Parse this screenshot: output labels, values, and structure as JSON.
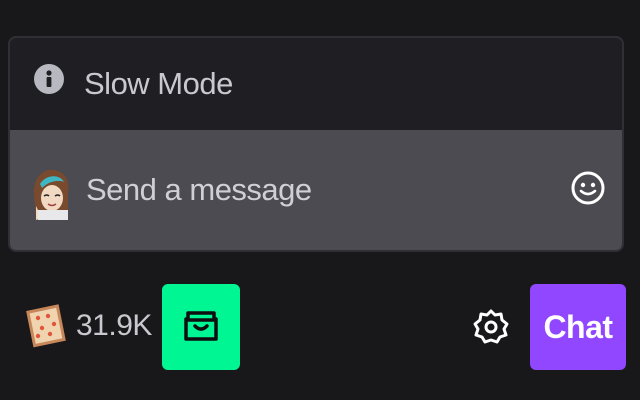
{
  "chat_box": {
    "slow_mode_label": "Slow Mode",
    "message_placeholder": "Send a message"
  },
  "bottom_bar": {
    "points_value": "31.9K",
    "chat_button_label": "Chat"
  },
  "icons": {
    "info": "info-icon",
    "avatar": "user-avatar",
    "emote": "smiley-face-icon",
    "points": "channel-points-icon",
    "store": "store-icon",
    "settings": "gear-icon"
  },
  "colors": {
    "background": "#18181b",
    "input_background": "#4b4b51",
    "store_accent": "#00f593",
    "chat_accent": "#9147ff"
  }
}
